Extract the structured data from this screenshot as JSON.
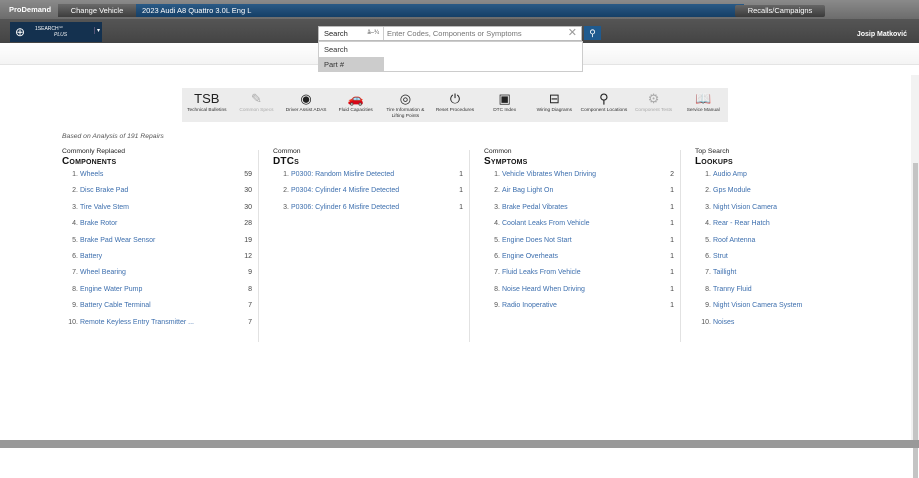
{
  "header": {
    "brand": "ProDemand",
    "change_vehicle": "Change Vehicle",
    "vehicle": "2023 Audi A8 Quattro 3.0L Eng L",
    "recalls": "Recalls/Campaigns",
    "user": "Josip Matković"
  },
  "onesearch": {
    "line1": "1SEARCH℠",
    "line2": "PLUS"
  },
  "search": {
    "type": "Search",
    "sort": "â–¾",
    "placeholder": "Enter Codes, Components or Symptoms",
    "options": [
      "Search",
      "Part #"
    ]
  },
  "toolbar": [
    {
      "label": "Technical Bulletins",
      "icon": "TSB"
    },
    {
      "label": "Common Specs",
      "icon": "✎",
      "disabled": true
    },
    {
      "label": "Driver Assist ADAS",
      "icon": "◉"
    },
    {
      "label": "Fluid Capacities",
      "icon": "🚗"
    },
    {
      "label": "Tire Information & Lifting Points",
      "icon": "◎"
    },
    {
      "label": "Reset Procedures",
      "icon": "⏻"
    },
    {
      "label": "DTC Index",
      "icon": "▣"
    },
    {
      "label": "Wiring Diagrams",
      "icon": "⊟"
    },
    {
      "label": "Component Locations",
      "icon": "⚲"
    },
    {
      "label": "Component Tests",
      "icon": "⚙",
      "disabled": true
    },
    {
      "label": "Service Manual",
      "icon": "📖"
    }
  ],
  "basis": "Based on Analysis of 191 Repairs",
  "columns": [
    {
      "sub": "Commonly Replaced",
      "head": "Components",
      "items": [
        [
          "Wheels",
          "59"
        ],
        [
          "Disc Brake Pad",
          "30"
        ],
        [
          "Tire Valve Stem",
          "30"
        ],
        [
          "Brake Rotor",
          "28"
        ],
        [
          "Brake Pad Wear Sensor",
          "19"
        ],
        [
          "Battery",
          "12"
        ],
        [
          "Wheel Bearing",
          "9"
        ],
        [
          "Engine Water Pump",
          "8"
        ],
        [
          "Battery Cable Terminal",
          "7"
        ],
        [
          "Remote Keyless Entry Transmitter ...",
          "7"
        ]
      ]
    },
    {
      "sub": "Common",
      "head": "DTCs",
      "items": [
        [
          "P0300: Random Misfire Detected",
          "1"
        ],
        [
          "P0304: Cylinder 4 Misfire Detected",
          "1"
        ],
        [
          "P0306: Cylinder 6 Misfire Detected",
          "1"
        ]
      ]
    },
    {
      "sub": "Common",
      "head": "Symptoms",
      "items": [
        [
          "Vehicle Vibrates When Driving",
          "2"
        ],
        [
          "Air Bag Light On",
          "1"
        ],
        [
          "Brake Pedal Vibrates",
          "1"
        ],
        [
          "Coolant Leaks From Vehicle",
          "1"
        ],
        [
          "Engine Does Not Start",
          "1"
        ],
        [
          "Engine Overheats",
          "1"
        ],
        [
          "Fluid Leaks From Vehicle",
          "1"
        ],
        [
          "Noise Heard When Driving",
          "1"
        ],
        [
          "Radio Inoperative",
          "1"
        ]
      ]
    },
    {
      "sub": "Top Search",
      "head": "Lookups",
      "items": [
        [
          "Audio Amp"
        ],
        [
          "Gps Module"
        ],
        [
          "Night Vision Camera"
        ],
        [
          "Rear - Rear Hatch"
        ],
        [
          "Roof Antenna"
        ],
        [
          "Strut"
        ],
        [
          "Taillight"
        ],
        [
          "Tranny Fluid"
        ],
        [
          "Night Vision Camera System"
        ],
        [
          "Noises"
        ]
      ]
    }
  ]
}
